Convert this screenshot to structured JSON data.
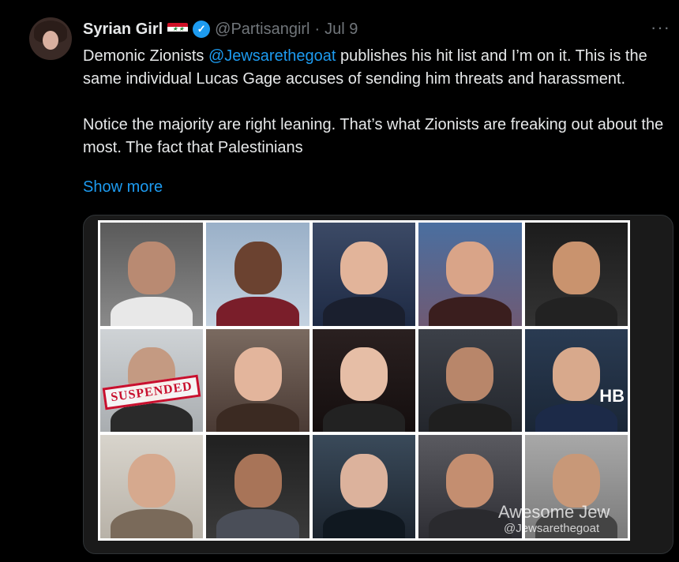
{
  "author": {
    "name": "Syrian Girl",
    "handle": "@Partisangirl",
    "separator": "·",
    "date": "Jul 9"
  },
  "tweet": {
    "text_part1": "Demonic Zionists ",
    "mention": "@Jewsarethegoat",
    "text_part2": " publishes his hit list and I’m on it. This is the same individual Lucas Gage accuses of sending him threats and harassment.\n\nNotice the majority are right leaning. That’s what Zionists are freaking out about the most. The fact that Palestinians",
    "show_more": "Show more"
  },
  "more_label": "···",
  "media": {
    "stamp": "SUSPENDED",
    "broadcaster_logo": "HB",
    "watermark": "Awesome Jew",
    "watermark_handle": "@Jewsarethegoat"
  },
  "colors": {
    "accent": "#1d9bf0",
    "background": "#000000",
    "secondary_text": "#71767b"
  }
}
